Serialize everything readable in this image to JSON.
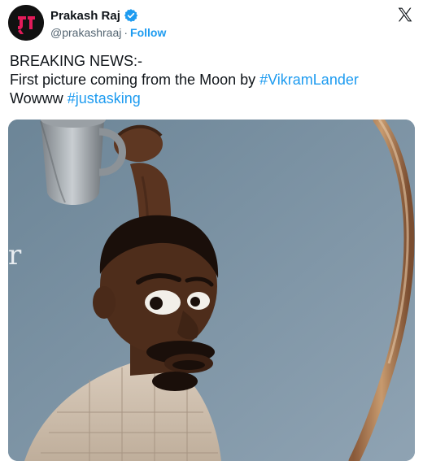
{
  "author": {
    "name": "Prakash Raj",
    "handle": "@prakashraaj",
    "separator": "·",
    "follow_label": "Follow",
    "avatar_icon": "avatar-logo-icon",
    "verified_icon": "verified-badge-icon"
  },
  "platform": {
    "logo_icon": "x-logo-icon"
  },
  "tweet": {
    "line1": "BREAKING NEWS:-",
    "line2_text": "First picture coming from the Moon by ",
    "line2_hashtag": "#VikramLander",
    "line3_text": "Wowww ",
    "line3_hashtag": "#justasking"
  },
  "media": {
    "kind": "cartoon-image",
    "partial_text": "r"
  },
  "colors": {
    "link": "#1d9bf0",
    "text": "#0f1419",
    "secondary": "#536471",
    "media_bg": "#6f8799"
  }
}
